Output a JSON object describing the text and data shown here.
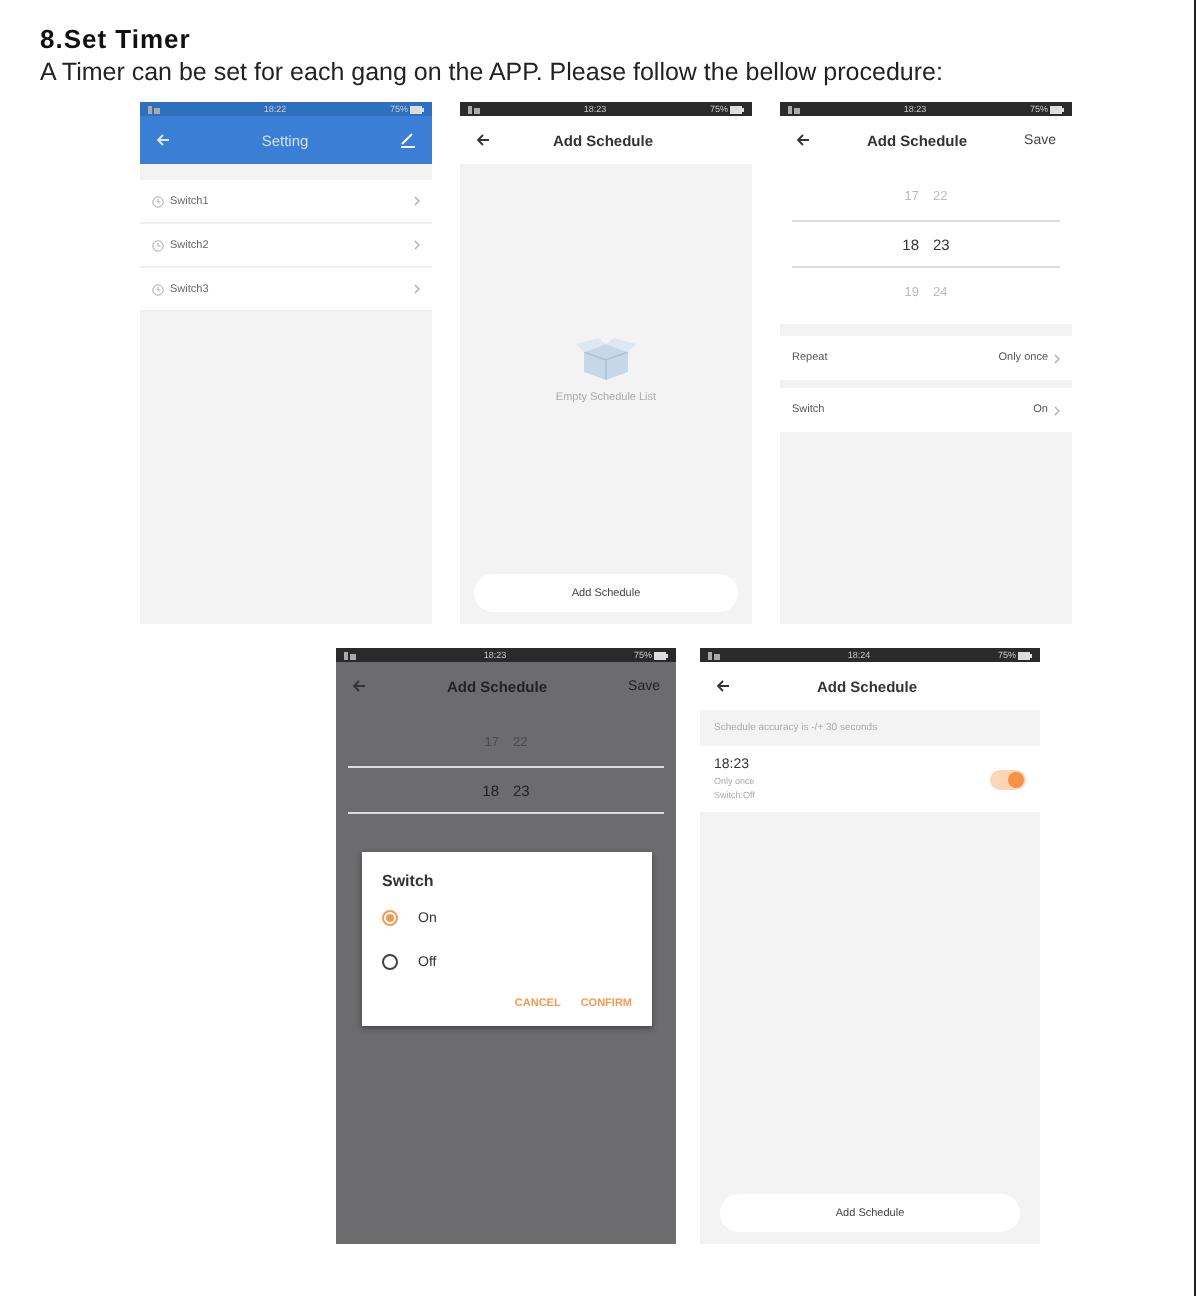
{
  "heading": "8.Set Timer",
  "intro": "A Timer can be set for each gang on the APP. Please follow the bellow procedure:",
  "screens": [
    {
      "kind": "settings-list",
      "status_time": "18:22",
      "battery": "75%",
      "title": "Setting",
      "items": [
        "Switch1",
        "Switch2",
        "Switch3"
      ]
    },
    {
      "kind": "empty-schedule",
      "status_time": "18:23",
      "battery": "75%",
      "title": "Add Schedule",
      "empty_text": "Empty Schedule List",
      "button": "Add Schedule"
    },
    {
      "kind": "time-picker",
      "status_time": "18:23",
      "battery": "75%",
      "title": "Add Schedule",
      "action": "Save",
      "picker": [
        {
          "hour": "17",
          "minute": "22",
          "selected": false
        },
        {
          "hour": "18",
          "minute": "23",
          "selected": true
        },
        {
          "hour": "19",
          "minute": "24",
          "selected": false
        }
      ],
      "rows": [
        {
          "label": "Repeat",
          "value": "Only once"
        },
        {
          "label": "Switch",
          "value": "On"
        }
      ]
    },
    {
      "kind": "switch-dialog",
      "status_time": "18:23",
      "battery": "75%",
      "title": "Add Schedule",
      "action": "Save",
      "picker": [
        {
          "hour": "17",
          "minute": "22",
          "selected": false
        },
        {
          "hour": "18",
          "minute": "23",
          "selected": true
        }
      ],
      "dialog": {
        "title": "Switch",
        "options": [
          {
            "label": "On",
            "selected": true
          },
          {
            "label": "Off",
            "selected": false
          }
        ],
        "buttons": [
          "CANCEL",
          "CONFIRM"
        ]
      }
    },
    {
      "kind": "schedule-list",
      "status_time": "18:24",
      "battery": "75%",
      "title": "Add Schedule",
      "note": "Schedule accuracy is -/+ 30 seconds",
      "entries": [
        {
          "time": "18:23",
          "repeat": "Only once",
          "switch": "Switch:Off",
          "on": true
        }
      ],
      "button": "Add Schedule"
    }
  ]
}
